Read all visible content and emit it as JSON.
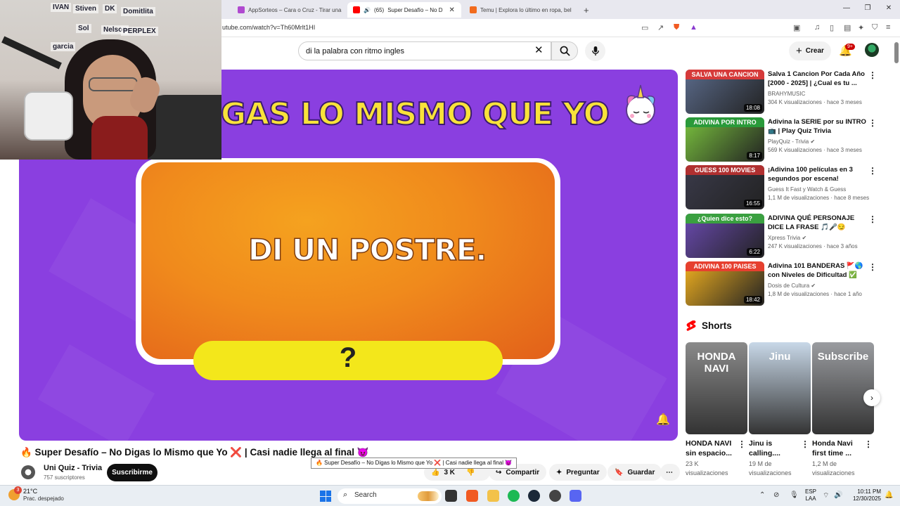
{
  "browser": {
    "tabs": [
      {
        "title": "AppSorteos – Cara o Cruz - Tirar una",
        "active": false
      },
      {
        "title": "(65)",
        "title2": "Super Desafío – No D",
        "active": true
      },
      {
        "title": "Temu | Explora lo último en ropa, bel",
        "active": false
      }
    ],
    "url": "utube.com/watch?v=Th60Mrlt1HI"
  },
  "youtube": {
    "search_query": "di la palabra con ritmo ingles",
    "create_label": "Crear",
    "notifications": "9+"
  },
  "video": {
    "headline": "GAS LO MISMO QUE YO",
    "prompt": "DI UN POSTRE.",
    "answer": "?",
    "title": "🔥 Super Desafío – No Digas lo Mismo que Yo ❌ | Casi nadie llega al final 😈",
    "tooltip": "🔥 Super Desafío – No Digas lo Mismo que Yo ❌ | Casi nadie llega al final 😈",
    "channel": "Uni Quiz - Trivia",
    "subscribers": "757 suscriptores",
    "subscribe_label": "Suscribirme",
    "likes": "3 K",
    "share_label": "Compartir",
    "ask_label": "Preguntar",
    "save_label": "Guardar"
  },
  "webcam_notes": [
    "IVAN",
    "Stiven",
    "DK",
    "Domitlita",
    "Sol",
    "Nelson",
    "PERPLEX",
    "garcia"
  ],
  "recommendations": [
    {
      "title": "Salva 1 Cancion Por Cada Año [2000 - 2025] | ¿Cual es tu ...",
      "channel": "BRAHYMUSIC",
      "meta": "304 K visualizaciones · hace 3 meses",
      "duration": "18:08",
      "band": "SALVA UNA CANCION",
      "band_color": "#d63a3a",
      "thumb_color": "#5a6a8a"
    },
    {
      "title": "Adivina la SERIE por su INTRO 📺 | Play Quiz Trivia",
      "channel": "PlayQuiz - Trivia ✔",
      "meta": "569 K visualizaciones · hace 3 meses",
      "duration": "8:17",
      "band": "ADIVINA POR INTRO",
      "band_color": "#2a9a3a",
      "thumb_color": "#7ac23e"
    },
    {
      "title": "¡Adivina 100 películas en 3 segundos por escena! Desafío...",
      "channel": "Guess It Fast y Watch & Guess",
      "meta": "1,1 M de visualizaciones · hace 8 meses",
      "duration": "16:55",
      "band": "GUESS 100 MOVIES",
      "band_color": "#b03030",
      "thumb_color": "#3a3a4a"
    },
    {
      "title": "ADIVINA QUÉ PERSONAJE DICE LA FRASE 🎵🎤😏",
      "channel": "Xpress Trivia ✔",
      "meta": "247 K visualizaciones · hace 3 años",
      "duration": "6:22",
      "band": "¿Quien dice esto?",
      "band_color": "#3aa040",
      "thumb_color": "#6a4ab0"
    },
    {
      "title": "Adivina 101 BANDERAS 🚩🌎 con Niveles de Dificultad ✅ -...",
      "channel": "Dosis de Cultura ✔",
      "meta": "1,8 M de visualizaciones · hace 1 año",
      "duration": "18:42",
      "band": "ADIVINA 100 PAISES",
      "band_color": "#e6402f",
      "thumb_color": "#f0b020"
    }
  ],
  "shorts": {
    "heading": "Shorts",
    "items": [
      {
        "title": "HONDA NAVI sin espacio...",
        "views": "23 K visualizaciones",
        "label": "HONDA NAVI",
        "color": "#8a8a8a"
      },
      {
        "title": "Jinu is calling....",
        "views": "19 M de visualizaciones",
        "label": "Jinu",
        "color": "#c8d8e8"
      },
      {
        "title": "Honda Navi first time ...",
        "views": "1,2 M de visualizaciones",
        "label": "Subscribe",
        "color": "#9a9ca0"
      }
    ]
  },
  "taskbar": {
    "weather_temp": "21°C",
    "weather_desc": "Prac. despejado",
    "weather_badge": "3",
    "search_label": "Search",
    "lang1": "ESP",
    "lang2": "LAA",
    "time": "10:11 PM",
    "date": "12/30/2025"
  }
}
